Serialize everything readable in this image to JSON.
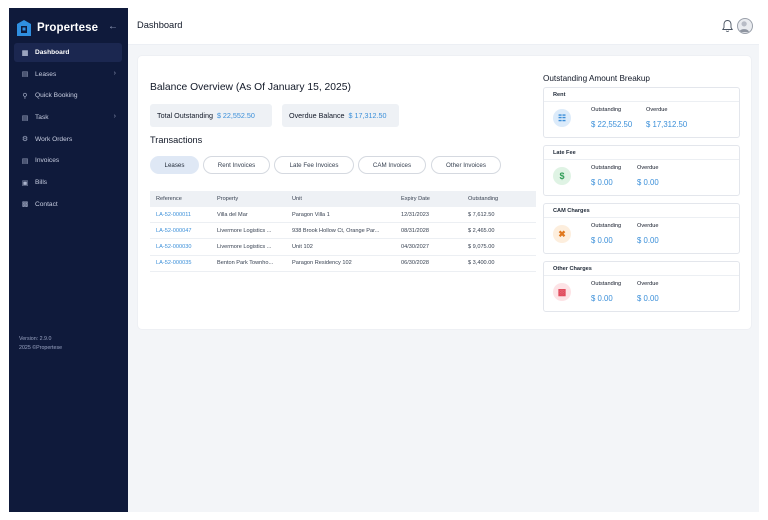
{
  "app": {
    "brand": "Propertese"
  },
  "sidebar": {
    "items": [
      {
        "label": "Dashboard",
        "icon": "grid-icon",
        "active": true
      },
      {
        "label": "Leases",
        "icon": "document-icon",
        "chevron": true
      },
      {
        "label": "Quick Booking",
        "icon": "booking-icon"
      },
      {
        "label": "Task",
        "icon": "clipboard-icon",
        "chevron": true
      },
      {
        "label": "Work Orders",
        "icon": "tools-icon"
      },
      {
        "label": "Invoices",
        "icon": "invoice-icon"
      },
      {
        "label": "Bills",
        "icon": "bill-icon"
      },
      {
        "label": "Contact",
        "icon": "contact-icon"
      }
    ],
    "version": "Version: 2.9.0",
    "copyright": "2025 ©Propertese"
  },
  "header": {
    "title": "Dashboard"
  },
  "balance": {
    "title": "Balance Overview (As Of January 15, 2025)",
    "total_outstanding_label": "Total Outstanding",
    "total_outstanding_value": "$ 22,552.50",
    "overdue_label": "Overdue Balance",
    "overdue_value": "$ 17,312.50"
  },
  "transactions": {
    "title": "Transactions",
    "tabs": [
      "Leases",
      "Rent Invoices",
      "Late Fee Invoices",
      "CAM Invoices",
      "Other Invoices"
    ],
    "active_tab": "Leases",
    "columns": [
      "Reference",
      "Property",
      "Unit",
      "Expiry Date",
      "Outstanding"
    ],
    "rows": [
      [
        "LA-52-000011",
        "Villa del Mar",
        "Paragon Villa 1",
        "12/31/2023",
        "$ 7,612.50"
      ],
      [
        "LA-52-000047",
        "Livermore Logistics ...",
        "938 Brook Hollow Ct, Orange Par...",
        "08/31/2028",
        "$ 2,465.00"
      ],
      [
        "LA-52-000030",
        "Livermore Logistics ...",
        "Unit 102",
        "04/30/2027",
        "$ 9,075.00"
      ],
      [
        "LA-52-000035",
        "Benton Park Townho...",
        "Paragon Residency 102",
        "06/30/2028",
        "$ 3,400.00"
      ]
    ]
  },
  "breakup": {
    "title": "Outstanding Amount Breakup",
    "outstanding_label": "Outstanding",
    "overdue_label": "Overdue",
    "cards": [
      {
        "name": "Rent",
        "outstanding": "$ 22,552.50",
        "overdue": "$ 17,312.50",
        "icon": "coins-icon",
        "color": "#3b8fd9",
        "bg": "#dcebfa"
      },
      {
        "name": "Late Fee",
        "outstanding": "$ 0.00",
        "overdue": "$ 0.00",
        "icon": "money-bag-icon",
        "color": "#2f9d57",
        "bg": "#dff3e4"
      },
      {
        "name": "CAM Charges",
        "outstanding": "$ 0.00",
        "overdue": "$ 0.00",
        "icon": "wrench-icon",
        "color": "#e0781f",
        "bg": "#fdeedd"
      },
      {
        "name": "Other Charges",
        "outstanding": "$ 0.00",
        "overdue": "$ 0.00",
        "icon": "receipt-icon",
        "color": "#e0485a",
        "bg": "#fde3e6"
      }
    ]
  }
}
